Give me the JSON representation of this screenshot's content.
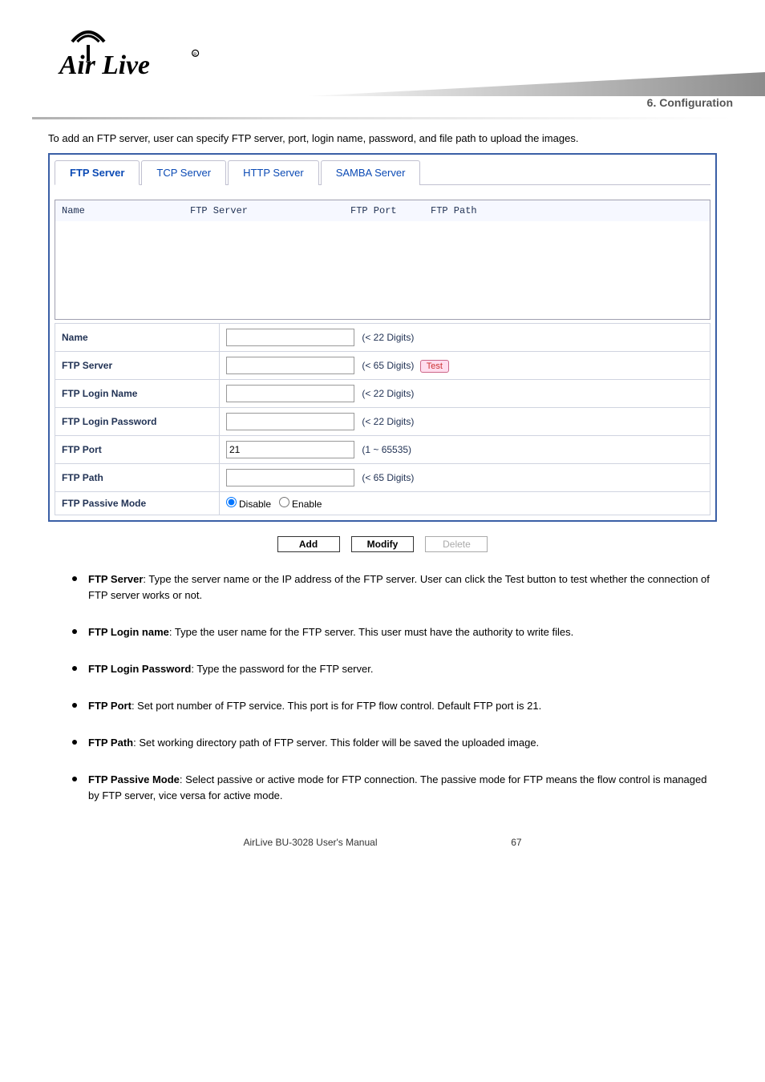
{
  "breadcrumb": "6. Configuration",
  "intro": "To add an FTP server, user can specify FTP server, port, login name, password, and file path to upload the images.",
  "tabs": [
    "FTP Server",
    "TCP Server",
    "HTTP Server",
    "SAMBA Server"
  ],
  "activeTab": 0,
  "listHeaders": {
    "name": "Name",
    "server": "FTP Server",
    "port": "FTP Port",
    "path": "FTP Path"
  },
  "form": {
    "name": {
      "label": "Name",
      "value": "",
      "hint": "(< 22 Digits)"
    },
    "server": {
      "label": "FTP Server",
      "value": "",
      "hint": "(< 65 Digits)",
      "test": "Test"
    },
    "login": {
      "label": "FTP Login Name",
      "value": "",
      "hint": "(< 22 Digits)"
    },
    "password": {
      "label": "FTP Login Password",
      "value": "",
      "hint": "(< 22 Digits)"
    },
    "port": {
      "label": "FTP Port",
      "value": "21",
      "hint": "(1 ~ 65535)"
    },
    "path": {
      "label": "FTP Path",
      "value": "",
      "hint": "(< 65 Digits)"
    },
    "passive": {
      "label": "FTP Passive Mode",
      "disable": "Disable",
      "enable": "Enable"
    }
  },
  "buttons": {
    "add": "Add",
    "modify": "Modify",
    "delete": "Delete"
  },
  "bullets": [
    {
      "title": "FTP Server",
      "body": ": Type the server name or the IP address of the FTP server. User can click the Test button to test whether the connection of FTP server works or not."
    },
    {
      "title": "FTP Login name",
      "body": ": Type the user name for the FTP server. This user must have the authority to write files."
    },
    {
      "title": "FTP Login Password",
      "body": ": Type the password for the FTP server."
    },
    {
      "title": "FTP Port",
      "body": ": Set port number of FTP service. This port is for FTP flow control. Default FTP port is 21."
    },
    {
      "title": "FTP Path",
      "body": ": Set working directory path of FTP server. This folder will be saved the uploaded image."
    },
    {
      "title": "FTP Passive Mode",
      "body": ": Select passive or active mode for FTP connection. The passive mode for FTP means the flow control is managed by FTP server, vice versa for active mode."
    }
  ],
  "pager": {
    "left": "AirLive BU-3028 User's Manual",
    "right": "67"
  }
}
